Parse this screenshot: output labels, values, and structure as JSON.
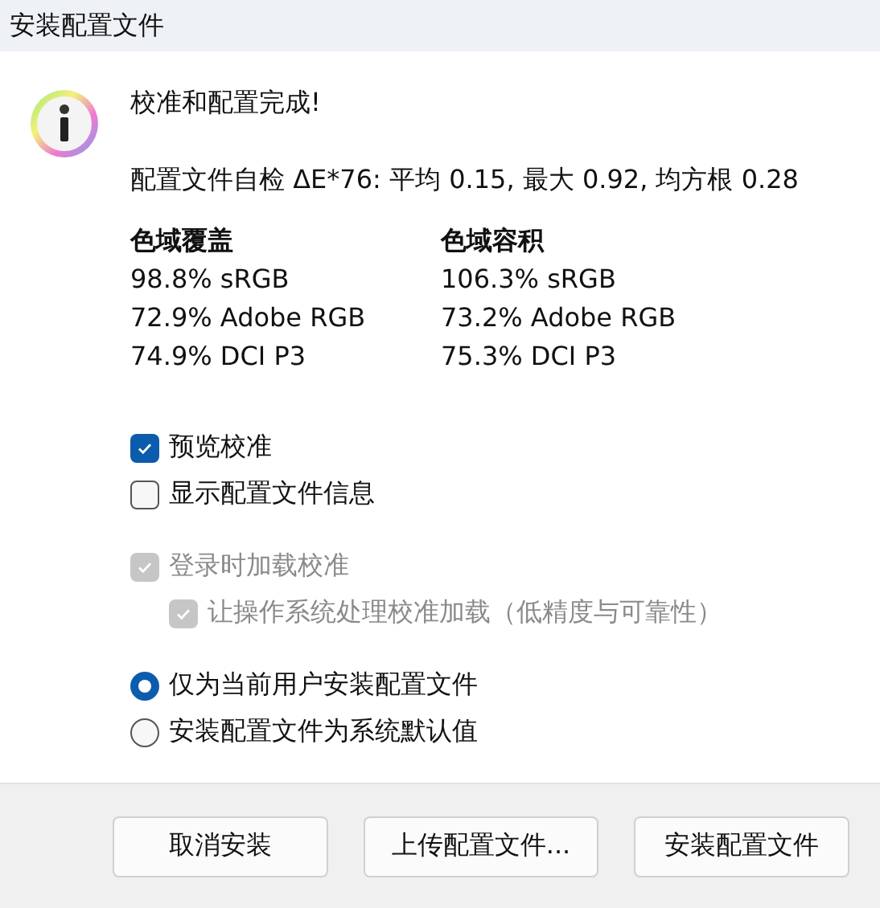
{
  "window": {
    "title": "安装配置文件"
  },
  "message": {
    "heading": "校准和配置完成!",
    "self_check": "配置文件自检 ΔE*76: 平均 0.15, 最大 0.92, 均方根 0.28"
  },
  "gamut": [
    {
      "title": "色域覆盖",
      "lines": [
        "98.8% sRGB",
        "72.9% Adobe RGB",
        "74.9% DCI P3"
      ]
    },
    {
      "title": "色域容积",
      "lines": [
        "106.3% sRGB",
        "73.2% Adobe RGB",
        "75.3% DCI P3"
      ]
    }
  ],
  "option_groups": [
    [
      {
        "label": "预览校准",
        "checked": true,
        "disabled": false
      },
      {
        "label": "显示配置文件信息",
        "checked": false,
        "disabled": false
      }
    ],
    [
      {
        "label": "登录时加载校准",
        "checked": true,
        "disabled": true,
        "children": [
          {
            "label": "让操作系统处理校准加载（低精度与可靠性）",
            "checked": true,
            "disabled": true
          }
        ]
      }
    ]
  ],
  "install_scope": [
    {
      "label": "仅为当前用户安装配置文件",
      "selected": true
    },
    {
      "label": "安装配置文件为系统默认值",
      "selected": false
    }
  ],
  "buttons": [
    "取消安装",
    "上传配置文件...",
    "安装配置文件"
  ]
}
